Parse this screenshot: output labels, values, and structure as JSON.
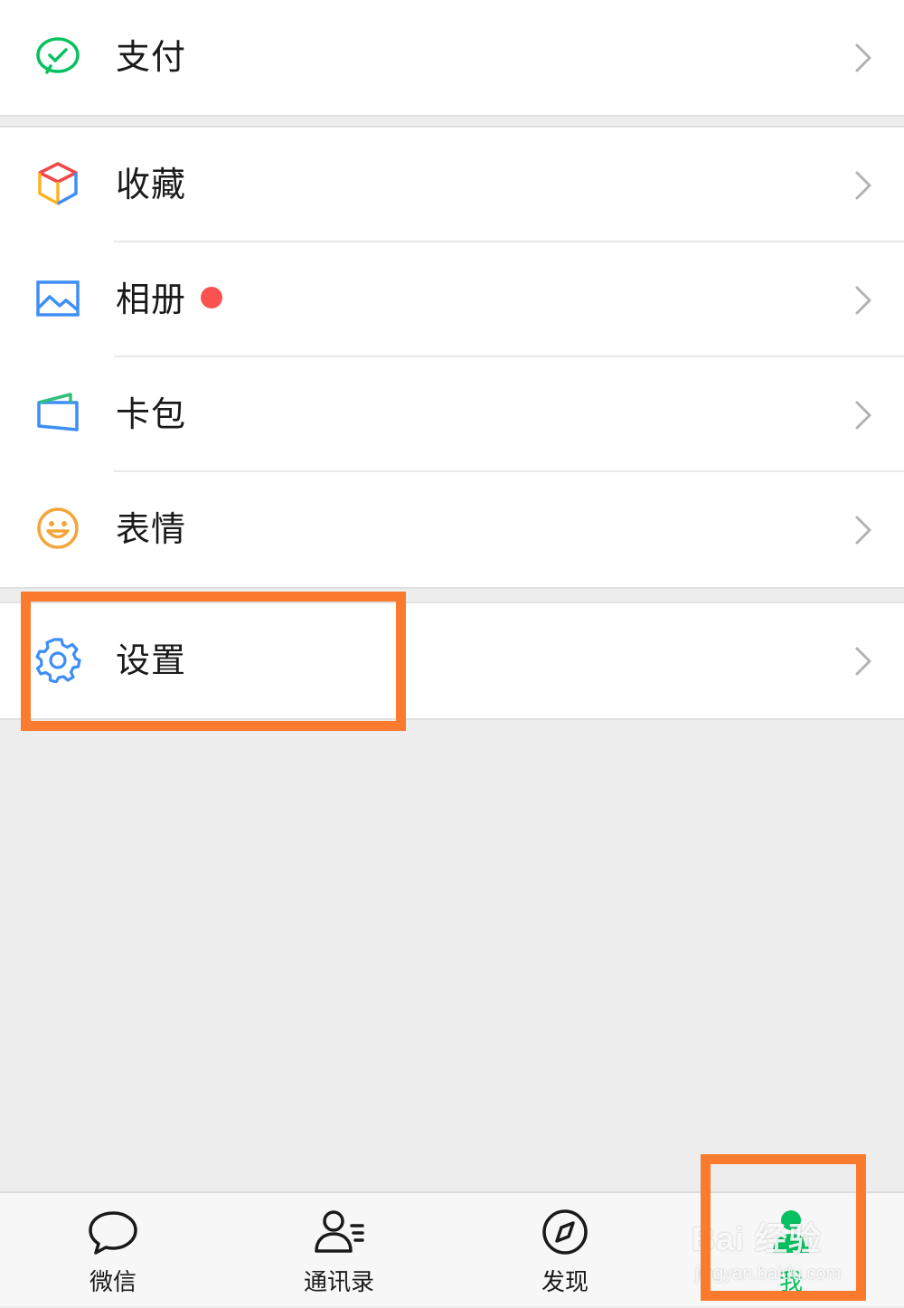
{
  "menu": {
    "pay": {
      "label": "支付",
      "icon": "wechat-pay-icon"
    },
    "favorites": {
      "label": "收藏",
      "icon": "favorites-cube-icon"
    },
    "album": {
      "label": "相册",
      "icon": "album-picture-icon",
      "has_red_dot": true
    },
    "cards": {
      "label": "卡包",
      "icon": "card-wallet-icon"
    },
    "stickers": {
      "label": "表情",
      "icon": "smiley-icon"
    },
    "settings": {
      "label": "设置",
      "icon": "gear-icon"
    }
  },
  "tabbar": {
    "tabs": [
      {
        "label": "微信",
        "icon": "chat-bubble-icon",
        "active": false
      },
      {
        "label": "通讯录",
        "icon": "contacts-icon",
        "active": false
      },
      {
        "label": "发现",
        "icon": "compass-icon",
        "active": false
      },
      {
        "label": "我",
        "icon": "me-person-icon",
        "active": true
      }
    ]
  },
  "watermark": {
    "brand": "Bai 经验",
    "url": "jingyan.baidu.com"
  },
  "colors": {
    "highlight": "#fa7a2e",
    "active_tab": "#07c160",
    "red_dot": "#fa5151",
    "background": "#ededed"
  }
}
